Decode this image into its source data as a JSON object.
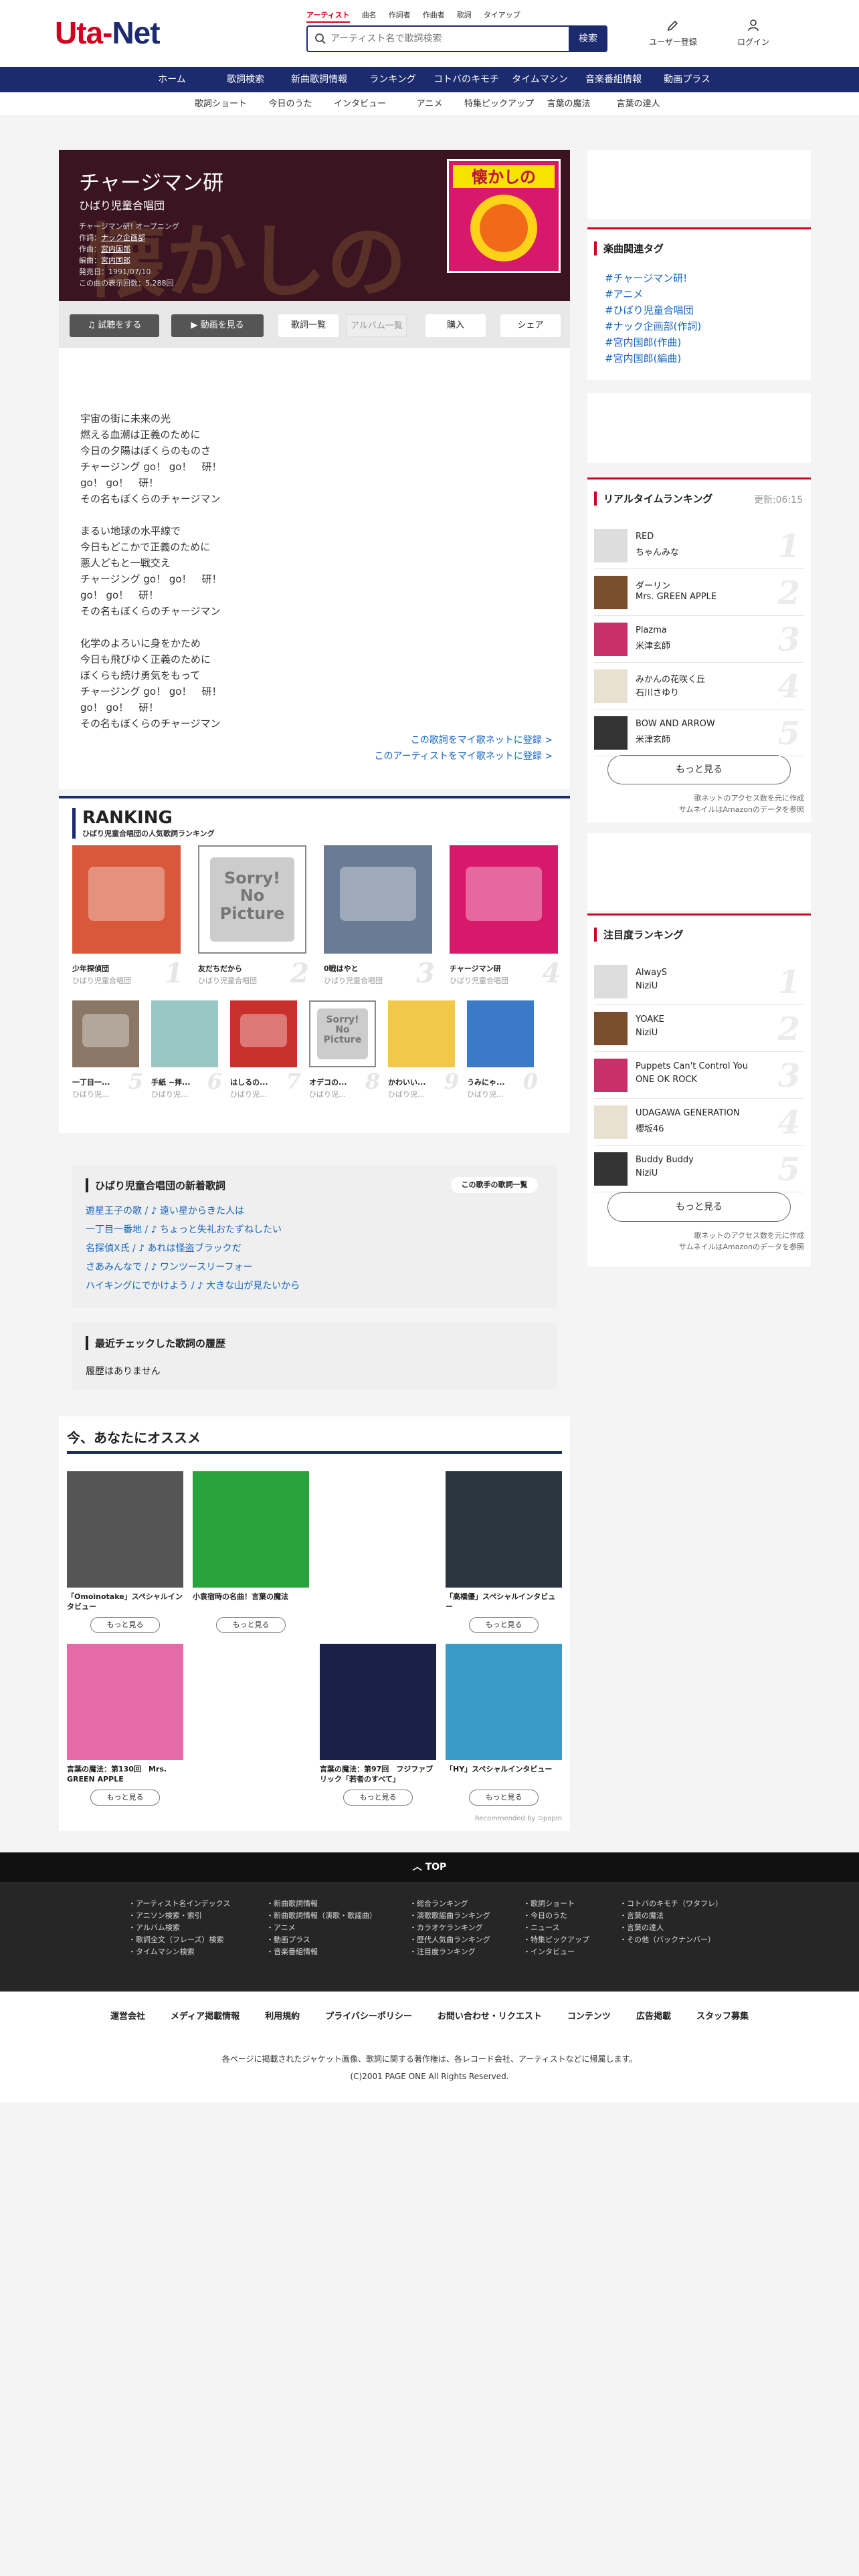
{
  "header": {
    "logo": {
      "part1": "Uta-",
      "part2": "Net"
    },
    "search_tabs": [
      "アーティスト",
      "曲名",
      "作詞者",
      "作曲者",
      "歌詞",
      "タイアップ"
    ],
    "search_placeholder": "アーティスト名で歌詞検索",
    "search_button": "検索",
    "register": "ユーザー登録",
    "login": "ログイン"
  },
  "nav_main": [
    "ホーム",
    "歌詞検索",
    "新曲歌詞情報",
    "ランキング",
    "コトバのキモチ",
    "タイムマシン",
    "音楽番組情報",
    "動画プラス"
  ],
  "nav_sub": [
    "歌詞ショート",
    "今日のうた",
    "インタビュー",
    "アニメ",
    "特集ピックアップ",
    "言葉の魔法",
    "言葉の達人"
  ],
  "song": {
    "title": "チャージマン研",
    "artist": "ひばり児童合唱団",
    "tieup": "チャージマン研! オープニング",
    "lyricist_label": "作詞：",
    "lyricist": "ナック企画部",
    "composer_label": "作曲：",
    "composer": "宮内国郎",
    "arranger_label": "編曲：",
    "arranger": "宮内国郎",
    "release": "発売日：1991/07/10",
    "views": "この曲の表示回数：5,288回",
    "jacket_text": "懐かしの",
    "actions": {
      "listen": "試聴をする",
      "video": "動画を見る",
      "lyrics_list": "歌詞一覧",
      "album_list": "アルバム一覧",
      "buy": "購入",
      "share": "シェア"
    },
    "lyrics": [
      "宇宙の街に未来の光",
      "燃える血潮は正義のために",
      "今日の夕陽はぼくらのものさ",
      "チャージング go！ go！　研！",
      "go！ go！　研！",
      "その名もぼくらのチャージマン",
      "",
      "まるい地球の水平線で",
      "今日もどこかで正義のために",
      "悪人どもと一戦交え",
      "チャージング go！ go！　研！",
      "go！ go！　研！",
      "その名もぼくらのチャージマン",
      "",
      "化学のよろいに身をかため",
      "今日も飛びゆく正義のために",
      "ぼくらも続け勇気をもって",
      "チャージング go！ go！　研！",
      "go！ go！　研！",
      "その名もぼくらのチャージマン"
    ],
    "register_song": "この歌詞をマイ歌ネットに登録 >",
    "register_artist": "このアーティストをマイ歌ネットに登録 >"
  },
  "ranking": {
    "title": "RANKING",
    "subtitle": "ひばり児童合唱団の人気歌詞ランキング",
    "items": [
      {
        "no": "1",
        "title": "少年探偵団",
        "artist": "ひばり児童合唱団"
      },
      {
        "no": "2",
        "title": "友だちだから",
        "artist": "ひばり児童合唱団"
      },
      {
        "no": "3",
        "title": "0戦はやと",
        "artist": "ひばり児童合唱団"
      },
      {
        "no": "4",
        "title": "チャージマン研",
        "artist": "ひばり児童合唱団"
      },
      {
        "no": "5",
        "title": "一丁目一...",
        "artist": "ひばり児..."
      },
      {
        "no": "6",
        "title": "手紙 ~拝...",
        "artist": "ひばり児..."
      },
      {
        "no": "7",
        "title": "はしるの...",
        "artist": "ひばり児..."
      },
      {
        "no": "8",
        "title": "オデコの...",
        "artist": "ひばり児..."
      },
      {
        "no": "9",
        "title": "かわいい...",
        "artist": "ひばり児..."
      },
      {
        "no": "0",
        "title": "うみにゃ...",
        "artist": "ひばり児..."
      }
    ],
    "sorry": {
      "line1": "Sorry!",
      "line2": "No",
      "line3": "Picture"
    }
  },
  "new_lyrics": {
    "title": "ひばり児童合唱団の新着歌詞",
    "button": "この歌手の歌詞一覧",
    "items": [
      "遊星王子の歌 / ♪ 遠い星からきた人は",
      "一丁目一番地 / ♪ ちょっと失礼おたずねしたい",
      "名探偵X氏 / ♪ あれは怪盗ブラックだ",
      "さあみんなで / ♪ ワンツースリーフォー",
      "ハイキングにでかけよう / ♪ 大きな山が見たいから"
    ]
  },
  "history": {
    "title": "最近チェックした歌詞の履歴",
    "empty": "履歴はありません"
  },
  "recommend": {
    "title": "今、あなたにオススメ",
    "more": "もっと見る",
    "items": [
      {
        "caption": "「Omoinotake」スペシャルインタビュー",
        "color": "#555"
      },
      {
        "caption": "小袁宿時の名曲！言葉の魔法",
        "color": "#2aa33d"
      },
      {
        "caption": "「高橋優」スペシャルインタビュー",
        "color": "#2a3540"
      },
      {
        "caption": "言葉の魔法：第130回　Mrs. GREEN APPLE",
        "color": "#e76aa8"
      },
      {
        "caption": "言葉の魔法：第97回　フジファブリック「若者のすべて」",
        "color": "#1a2148"
      },
      {
        "caption": "「HY」スペシャルインタビュー",
        "color": "#3a9bc8"
      }
    ],
    "credit": "Recommended by ⊃popIn"
  },
  "tags": {
    "title": "楽曲関連タグ",
    "items": [
      "#チャージマン研!",
      "#アニメ",
      "#ひばり児童合唱団",
      "#ナック企画部(作詞)",
      "#宮内国郎(作曲)",
      "#宮内国郎(編曲)"
    ]
  },
  "realtime": {
    "title": "リアルタイムランキング",
    "updated": "更新:06:15",
    "items": [
      {
        "no": "1",
        "title": "RED",
        "artist": "ちゃんみな"
      },
      {
        "no": "2",
        "title": "ダーリン",
        "artist": "Mrs. GREEN APPLE"
      },
      {
        "no": "3",
        "title": "Plazma",
        "artist": "米津玄師"
      },
      {
        "no": "4",
        "title": "みかんの花咲く丘",
        "artist": "石川さゆり"
      },
      {
        "no": "5",
        "title": "BOW AND ARROW",
        "artist": "米津玄師"
      }
    ],
    "more": "もっと見る",
    "note1": "歌ネットのアクセス数を元に作成",
    "note2": "サムネイルはAmazonのデータを参照"
  },
  "attention": {
    "title": "注目度ランキング",
    "items": [
      {
        "no": "1",
        "title": "AlwayS",
        "artist": "NiziU"
      },
      {
        "no": "2",
        "title": "YOAKE",
        "artist": "NiziU"
      },
      {
        "no": "3",
        "title": "Puppets Can't Control You",
        "artist": "ONE OK ROCK"
      },
      {
        "no": "4",
        "title": "UDAGAWA GENERATION",
        "artist": "櫻坂46"
      },
      {
        "no": "5",
        "title": "Buddy Buddy",
        "artist": "NiziU"
      }
    ],
    "more": "もっと見る",
    "note1": "歌ネットのアクセス数を元に作成",
    "note2": "サムネイルはAmazonのデータを参照"
  },
  "footer": {
    "top": "TOP",
    "col1": [
      "・アーティスト名インデックス",
      "・アニソン検索・索引",
      "・アルバム検索",
      "・歌詞全文（フレーズ）検索",
      "・タイムマシン検索"
    ],
    "col2": [
      "・新曲歌詞情報",
      "・新曲歌詞情報（演歌・歌謡曲）",
      "・アニメ",
      "・動画プラス",
      "・音楽番組情報"
    ],
    "col3": [
      "・総合ランキング",
      "・演歌歌謡曲ランキング",
      "・カラオケランキング",
      "・歴代人気曲ランキング",
      "・注目度ランキング"
    ],
    "col4": [
      "・歌詞ショート",
      "・今日のうた",
      "・ニュース",
      "・特集ピックアップ",
      "・インタビュー"
    ],
    "col5": [
      "・コトバのキモチ（ワタフレ）",
      "・言葉の魔法",
      "・言葉の達人",
      "・その他（バックナンバー）"
    ],
    "nav": [
      "運営会社",
      "メディア掲載情報",
      "利用規約",
      "プライバシーポリシー",
      "お問い合わせ・リクエスト",
      "コンテンツ",
      "広告掲載",
      "スタッフ募集"
    ],
    "notice": "各ページに掲載されたジャケット画像、歌詞に関する著作権は、各レコード会社、アーティストなどに帰属します。",
    "copyright": "(C)2001 PAGE ONE All Rights Reserved."
  }
}
